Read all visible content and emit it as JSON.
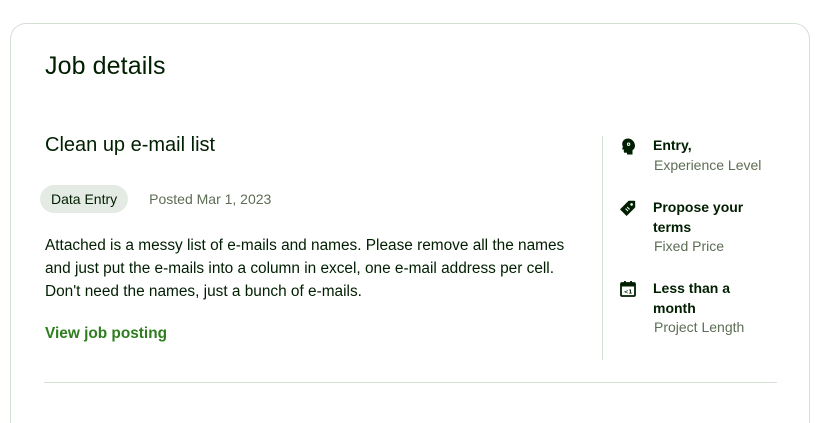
{
  "section": {
    "heading": "Job details"
  },
  "job": {
    "title": "Clean up e-mail list",
    "category_tag": "Data Entry",
    "posted": "Posted Mar 1, 2023",
    "description": "Attached is a messy list of e-mails and names. Please remove all the names and just put the e-mails into a column in excel, one e-mail address per cell. Don't need the names, just a bunch of e-mails.",
    "view_link": "View job posting"
  },
  "features": [
    {
      "icon": "brain-icon",
      "value": "Entry,",
      "label": "Experience Level"
    },
    {
      "icon": "price-tag-icon",
      "value": "Propose your terms",
      "label": "Fixed Price"
    },
    {
      "icon": "calendar-icon",
      "value": "Less than a month",
      "label": "Project Length"
    }
  ]
}
